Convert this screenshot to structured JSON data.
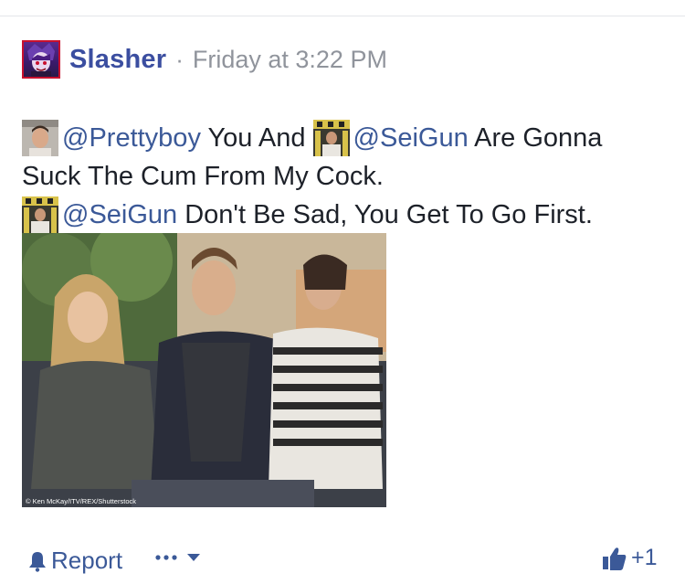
{
  "post": {
    "author": "Slasher",
    "separator": "·",
    "timestamp": "Friday at 3:22 PM",
    "line1": {
      "mention1": "@Prettyboy",
      "text1": " You And ",
      "mention2": "@SeiGun",
      "text2": " Are Gonna"
    },
    "line2": "Suck The Cum From My Cock.",
    "line3": {
      "mention": "@SeiGun",
      "text": " Don't Be Sad, You Get To Go First."
    },
    "photo_credit": "© Ken McKay/ITV/REX/Shutterstock"
  },
  "actions": {
    "report_label": "Report",
    "more_label": "•••",
    "like_count": "+1"
  },
  "colors": {
    "author": "#3b4ea0",
    "link": "#3b5998",
    "meta": "#90949c",
    "text": "#1d2129"
  },
  "icons": [
    "bell-icon",
    "more-dots-icon",
    "dropdown-caret-icon",
    "thumbs-up-icon"
  ]
}
